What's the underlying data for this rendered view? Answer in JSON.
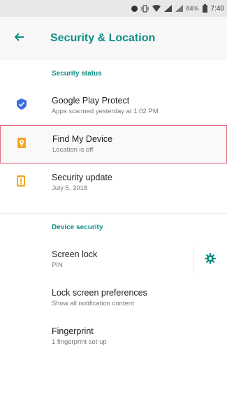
{
  "statusbar": {
    "battery_percent": "84%",
    "time": "7:40"
  },
  "appbar": {
    "title": "Security & Location"
  },
  "colors": {
    "accent": "#0e8f86",
    "shield_blue": "#3a6fe0",
    "find_device_orange": "#f5a623",
    "update_orange": "#f5a623",
    "highlight_border": "#e36d80"
  },
  "sections": {
    "security_status": {
      "header": "Security status",
      "items": [
        {
          "primary": "Google Play Protect",
          "secondary": "Apps scanned yesterday at 1:02 PM",
          "icon": "shield-icon"
        },
        {
          "primary": "Find My Device",
          "secondary": "Location is off",
          "icon": "find-device-icon"
        },
        {
          "primary": "Security update",
          "secondary": "July 5, 2018",
          "icon": "security-update-icon"
        }
      ]
    },
    "device_security": {
      "header": "Device security",
      "items": [
        {
          "primary": "Screen lock",
          "secondary": "PIN"
        },
        {
          "primary": "Lock screen preferences",
          "secondary": "Show all notification content"
        },
        {
          "primary": "Fingerprint",
          "secondary": "1 fingerprint set up"
        }
      ]
    }
  }
}
